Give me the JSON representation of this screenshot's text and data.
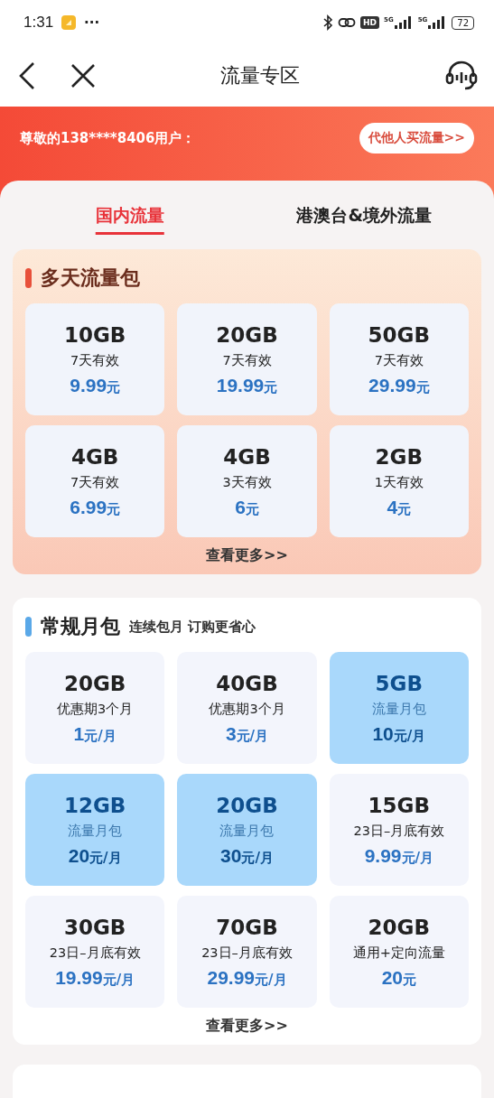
{
  "status_bar": {
    "time": "1:31",
    "more": "···",
    "hd": "HD",
    "signal_1": "5G",
    "signal_2": "5G",
    "battery": "72"
  },
  "nav": {
    "title": "流量专区"
  },
  "banner": {
    "greeting": "尊敬的138****8406用户：",
    "button": "代他人买流量>>"
  },
  "tabs": [
    {
      "label": "国内流量",
      "selected": true
    },
    {
      "label": "港澳台&境外流量",
      "selected": false
    }
  ],
  "sections": [
    {
      "title": "多天流量包",
      "color": "#e8503a",
      "kind": "warm",
      "more": "查看更多>>",
      "packs": [
        {
          "size": "10GB",
          "desc": "7天有效",
          "price": "9.99",
          "unit": "元",
          "selected": false
        },
        {
          "size": "20GB",
          "desc": "7天有效",
          "price": "19.99",
          "unit": "元",
          "selected": false
        },
        {
          "size": "50GB",
          "desc": "7天有效",
          "price": "29.99",
          "unit": "元",
          "selected": false
        },
        {
          "size": "4GB",
          "desc": "7天有效",
          "price": "6.99",
          "unit": "元",
          "selected": false
        },
        {
          "size": "4GB",
          "desc": "3天有效",
          "price": "6",
          "unit": "元",
          "selected": false
        },
        {
          "size": "2GB",
          "desc": "1天有效",
          "price": "4",
          "unit": "元",
          "selected": false
        }
      ]
    },
    {
      "title": "常规月包",
      "subtitle": "连续包月 订购更省心",
      "color": "#5aa8e8",
      "kind": "plain",
      "more": "查看更多>>",
      "packs": [
        {
          "size": "20GB",
          "desc": "优惠期3个月",
          "price": "1",
          "unit": "元/月",
          "selected": false
        },
        {
          "size": "40GB",
          "desc": "优惠期3个月",
          "price": "3",
          "unit": "元/月",
          "selected": false
        },
        {
          "size": "5GB",
          "desc": "流量月包",
          "price": "10",
          "unit": "元/月",
          "selected": true
        },
        {
          "size": "12GB",
          "desc": "流量月包",
          "price": "20",
          "unit": "元/月",
          "selected": true
        },
        {
          "size": "20GB",
          "desc": "流量月包",
          "price": "30",
          "unit": "元/月",
          "selected": true
        },
        {
          "size": "15GB",
          "desc": "23日–月底有效",
          "price": "9.99",
          "unit": "元/月",
          "selected": false
        },
        {
          "size": "30GB",
          "desc": "23日–月底有效",
          "price": "19.99",
          "unit": "元/月",
          "selected": false
        },
        {
          "size": "70GB",
          "desc": "23日–月底有效",
          "price": "29.99",
          "unit": "元/月",
          "selected": false
        },
        {
          "size": "20GB",
          "desc": "通用+定向流量",
          "price": "20",
          "unit": "元",
          "selected": false
        }
      ]
    }
  ]
}
